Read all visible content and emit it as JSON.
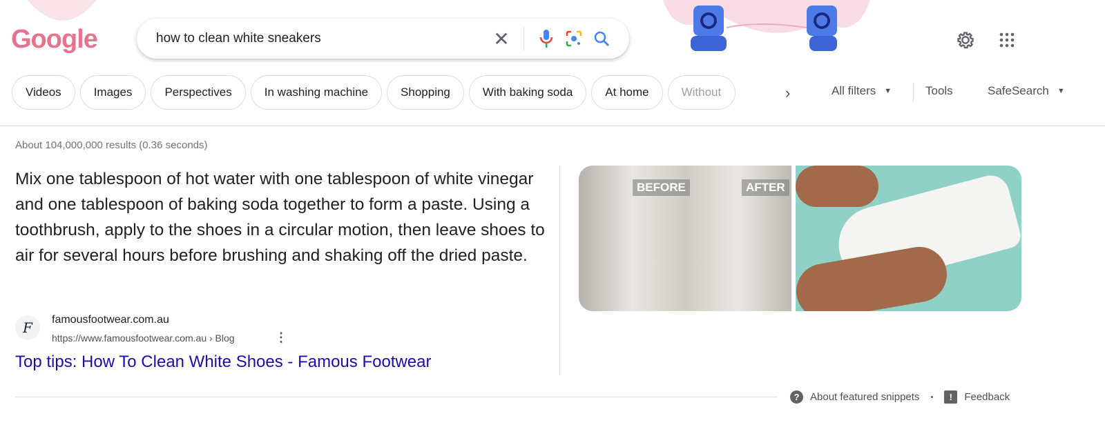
{
  "header": {
    "logo_text": "Google",
    "search": {
      "value": "how to clean white sneakers",
      "placeholder": ""
    },
    "icons": [
      "close-icon",
      "microphone-icon",
      "lens-icon",
      "search-icon",
      "gear-icon",
      "apps-grid-icon"
    ]
  },
  "chips": [
    {
      "label": "Videos"
    },
    {
      "label": "Images"
    },
    {
      "label": "Perspectives"
    },
    {
      "label": "In washing machine"
    },
    {
      "label": "Shopping"
    },
    {
      "label": "With baking soda"
    },
    {
      "label": "At home"
    },
    {
      "label": "Without"
    }
  ],
  "tools": {
    "all_filters": "All filters",
    "tools": "Tools",
    "safesearch": "SafeSearch"
  },
  "results_stats": "About 104,000,000 results (0.36 seconds)",
  "featured_snippet": {
    "text": "Mix one tablespoon of hot water with one tablespoon of white vinegar and one tablespoon of baking soda together to form a paste. Using a toothbrush, apply to the shoes in a circular motion, then leave shoes to air for several hours before brushing and shaking off the dried paste.",
    "image_labels": {
      "before": "BEFORE",
      "after": "AFTER"
    },
    "source": {
      "favicon_letter": "F",
      "site_name": "famousfootwear.com.au",
      "url": "https://www.famousfootwear.com.au › Blog",
      "title": "Top tips: How To Clean White Shoes - Famous Footwear"
    },
    "footer": {
      "about": "About featured snippets",
      "separator": "•",
      "feedback": "Feedback"
    }
  },
  "colors": {
    "link": "#1a0dab",
    "logo": "#e8738d",
    "accent_blue": "#4285f4"
  }
}
